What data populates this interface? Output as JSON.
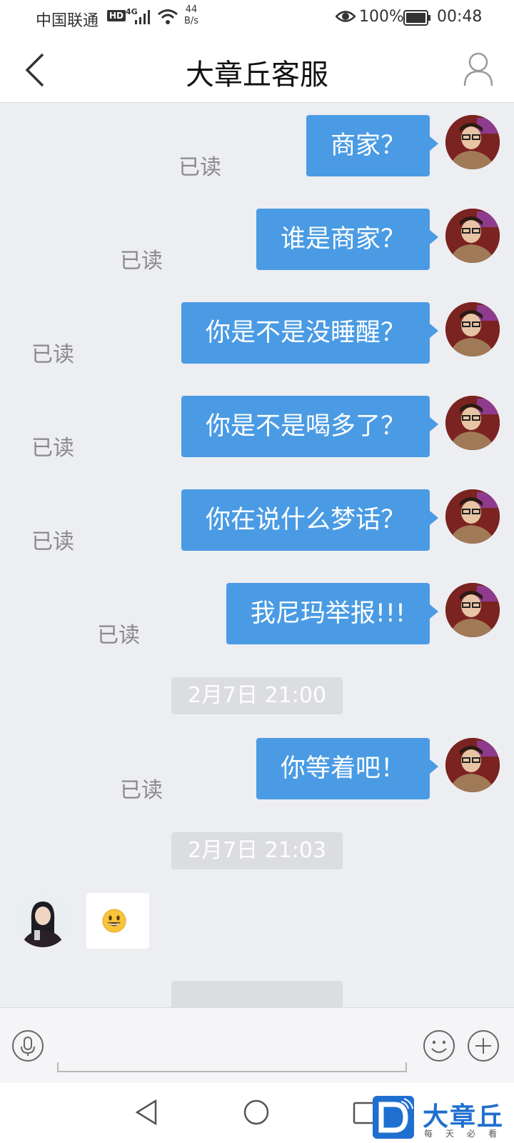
{
  "status_bar": {
    "carrier": "中国联通",
    "hd": "HD",
    "network": "4G",
    "speed_value": "44",
    "speed_unit": "B/s",
    "battery": "100%",
    "time": "00:48"
  },
  "header": {
    "title": "大章丘客服"
  },
  "messages": [
    {
      "text": "商家？",
      "read": "已读"
    },
    {
      "text": "谁是商家？",
      "read": "已读"
    },
    {
      "text": "你是不是没睡醒？",
      "read": "已读"
    },
    {
      "text": "你是不是喝多了？",
      "read": "已读"
    },
    {
      "text": "你在说什么梦话？",
      "read": "已读"
    },
    {
      "text": "我尼玛举报!!!",
      "read": "已读"
    },
    {
      "text": "你等着吧！",
      "read": "已读"
    }
  ],
  "timestamps": [
    "2月7日 21:00",
    "2月7日 21:03"
  ],
  "incoming": {
    "emoji": "😃"
  },
  "watermark": {
    "brand": "大章丘",
    "tagline": "每天必看"
  },
  "colors": {
    "bubble_out": "#4A9BE4",
    "chat_bg": "#EDEEF2",
    "timestamp_pill": "#DCDDE1"
  }
}
